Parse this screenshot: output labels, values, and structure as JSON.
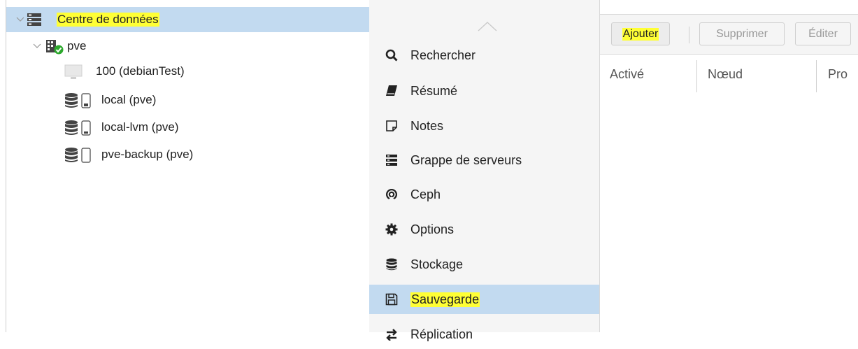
{
  "tree": {
    "nodes": [
      {
        "label": "Centre de données",
        "icon": "server-stack-icon",
        "expanded": true,
        "selected": true
      },
      {
        "label": "pve",
        "icon": "node-online-icon",
        "expanded": true
      },
      {
        "label": "100 (debianTest)",
        "icon": "monitor-icon"
      },
      {
        "label": "local (pve)",
        "icon": "storage-icon"
      },
      {
        "label": "local-lvm (pve)",
        "icon": "storage-icon"
      },
      {
        "label": "pve-backup (pve)",
        "icon": "storage-icon"
      }
    ]
  },
  "menu": {
    "items": [
      {
        "label": "Rechercher",
        "icon": "search-icon"
      },
      {
        "label": "Résumé",
        "icon": "book-icon"
      },
      {
        "label": "Notes",
        "icon": "notes-icon"
      },
      {
        "label": "Grappe de serveurs",
        "icon": "server-stack-icon"
      },
      {
        "label": "Ceph",
        "icon": "ceph-icon"
      },
      {
        "label": "Options",
        "icon": "gear-icon"
      },
      {
        "label": "Stockage",
        "icon": "database-icon"
      },
      {
        "label": "Sauvegarde",
        "icon": "floppy-icon",
        "selected": true
      },
      {
        "label": "Réplication",
        "icon": "replication-icon"
      }
    ]
  },
  "toolbar": {
    "add_label": "Ajouter",
    "delete_label": "Supprimer",
    "edit_label": "Éditer"
  },
  "grid": {
    "columns": [
      "Activé",
      "Nœud",
      "Pro"
    ]
  },
  "colors": {
    "selection": "#c2daf0",
    "highlight": "#ffff35",
    "panel_bg": "#f5f5f5"
  }
}
